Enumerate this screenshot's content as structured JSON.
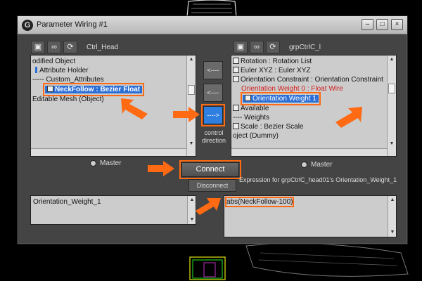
{
  "window": {
    "title": "Parameter Wiring #1",
    "controls": {
      "minimize": "–",
      "maximize": "□",
      "close": "×"
    }
  },
  "left_panel": {
    "node_name": "Ctrl_Head",
    "tree": [
      "odified Object",
      "Attribute Holder",
      "----- Custom_Attributes",
      "NeckFollow : Bezier Float",
      "Editable Mesh (Object)"
    ],
    "master_label": "Master",
    "expression": "Orientation_Weight_1"
  },
  "right_panel": {
    "node_name": "grpCtrlC_l",
    "tree": [
      "Rotation : Rotation List",
      "Euler XYZ : Euler XYZ",
      "Orientation Constraint : Orientation Constraint",
      "Orientation Weight 0 : Float Wire",
      "Orientation Weight 1",
      "Available",
      "---- Weights",
      "Scale : Bezier Scale",
      "oject (Dummy)"
    ],
    "master_label": "Master",
    "expression_label": "Expression for grpCtrlC_head01's Orientation_Weight_1",
    "expression": "abs(NeckFollow-100)"
  },
  "direction": {
    "left_arrow_top": "<----",
    "left_arrow_mid": "<----",
    "right_arrow": "---->",
    "label": "control direction"
  },
  "buttons": {
    "connect": "Connect",
    "disconnect": "Disconnect"
  },
  "accent_color": "#ff6a13",
  "selection_color": "#2b6fd6"
}
